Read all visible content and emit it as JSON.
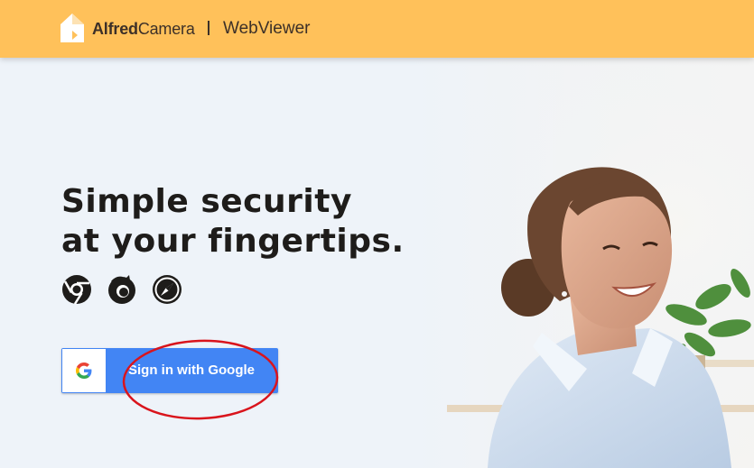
{
  "header": {
    "brand_bold": "Alfred",
    "brand_regular": "Camera",
    "product": "WebViewer",
    "logo_icon": "alfred-home-icon"
  },
  "hero": {
    "headline_line1": "Simple security",
    "headline_line2": "at your fingertips.",
    "browser_icons": [
      "chrome-icon",
      "firefox-icon",
      "safari-icon"
    ],
    "photo": "smiling-woman-photo"
  },
  "signin": {
    "label": "Sign in with Google",
    "icon": "google-g-icon"
  },
  "colors": {
    "header_bg": "#ffc15a",
    "button_bg": "#4285f4",
    "annotation": "#d9141c",
    "text_dark": "#1e1c1a"
  }
}
